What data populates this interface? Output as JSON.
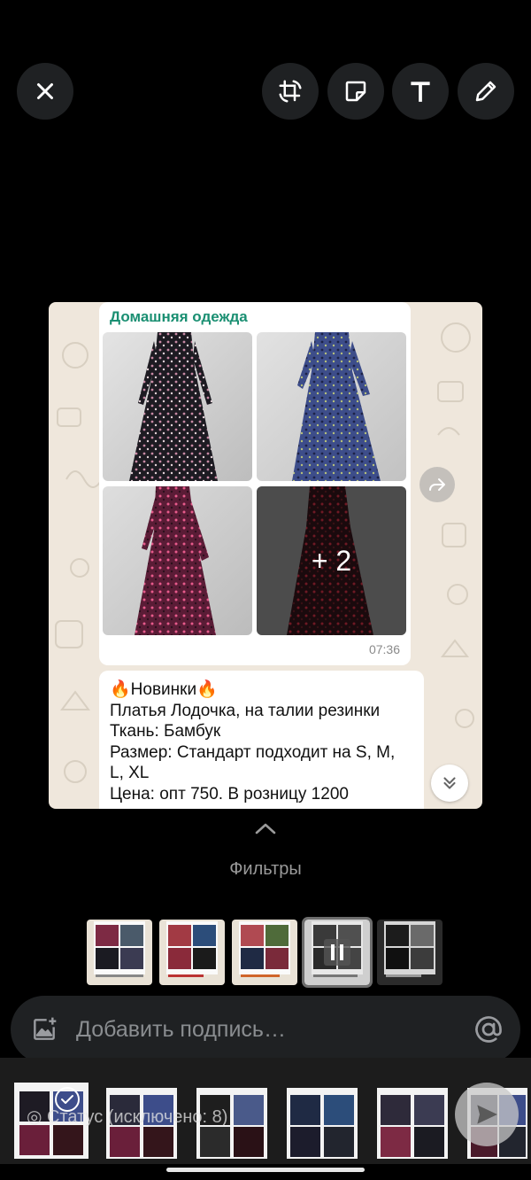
{
  "toolbar": {
    "close_icon": "close-icon",
    "crop_rotate_icon": "crop-rotate-icon",
    "sticker_icon": "sticker-icon",
    "text_icon": "text-icon",
    "pencil_icon": "pencil-icon"
  },
  "preview": {
    "chat_title": "Домашняя одежда",
    "more_count": "+ 2",
    "time": "07:36",
    "message_lines": [
      "🔥Новинки🔥",
      "Платья Лодочка, на талии резинки",
      "Ткань: Бамбук",
      "Размер: Стандарт подходит на S, M,",
      "L, XL",
      "Цена: опт 750. В розницу 1200"
    ]
  },
  "filters": {
    "label": "Фильтры",
    "options_count": 5,
    "selected_index": 3
  },
  "caption": {
    "placeholder": "Добавить подпись…"
  },
  "status": {
    "text": "Статус (исключено: 8)"
  },
  "colors": {
    "background": "#000000",
    "chat_title": "#1a8f72",
    "button_bg": "#1f2123",
    "wallpaper": "#efe7dc"
  }
}
